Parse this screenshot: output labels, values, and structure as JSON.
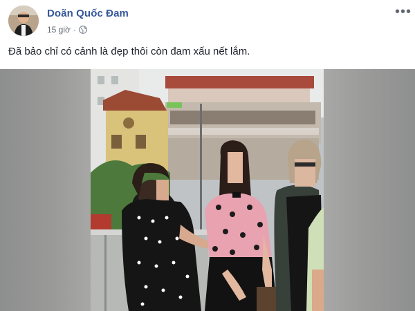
{
  "post": {
    "author": "Doãn Quốc Đam",
    "time": "15 giờ",
    "separator": "·",
    "privacy_icon": "globe-icon",
    "more_icon": "more-options-icon",
    "more_glyph": "•••",
    "text": "Đã bảo chỉ có cảnh là đẹp thôi còn đam xấu nết lắm."
  },
  "colors": {
    "author": "#365899",
    "meta": "#616770",
    "text": "#1d2129",
    "pink_shirt": "#e8a2b0",
    "polka_dress": "#141414"
  }
}
